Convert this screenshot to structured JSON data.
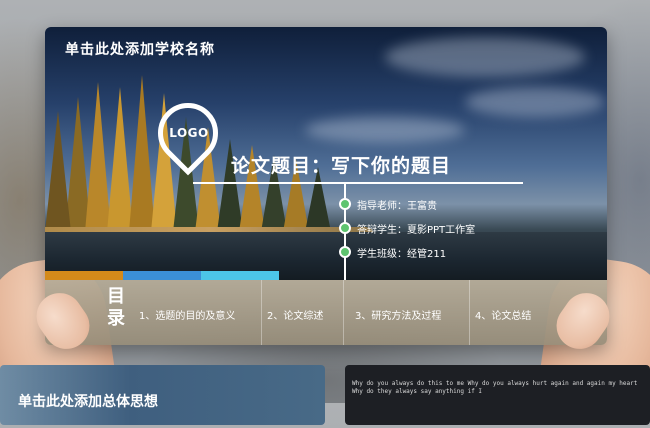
{
  "slide": {
    "school_title": "单击此处添加学校名称",
    "logo_text": "LOGO",
    "thesis_title": "论文题目：写下你的题目",
    "info": [
      {
        "label": "指导老师：王富贵"
      },
      {
        "label": "答辩学生：夏影PPT工作室"
      },
      {
        "label": "学生班级：经管211"
      }
    ],
    "accent_colors": [
      "#d48a1a",
      "#3b8fd6",
      "#4cc6e8"
    ]
  },
  "menu": {
    "heading": "目录",
    "items": [
      {
        "label": "1、选题的目的及意义"
      },
      {
        "label": "2、论文综述"
      },
      {
        "label": "3、研究方法及过程"
      },
      {
        "label": "4、论文总结"
      }
    ]
  },
  "thumbnails": {
    "left_title": "单击此处添加总体思想",
    "right_text": "Why do you always do this to me Why do you always hurt again and again my heart Why do they always say anything if I"
  }
}
